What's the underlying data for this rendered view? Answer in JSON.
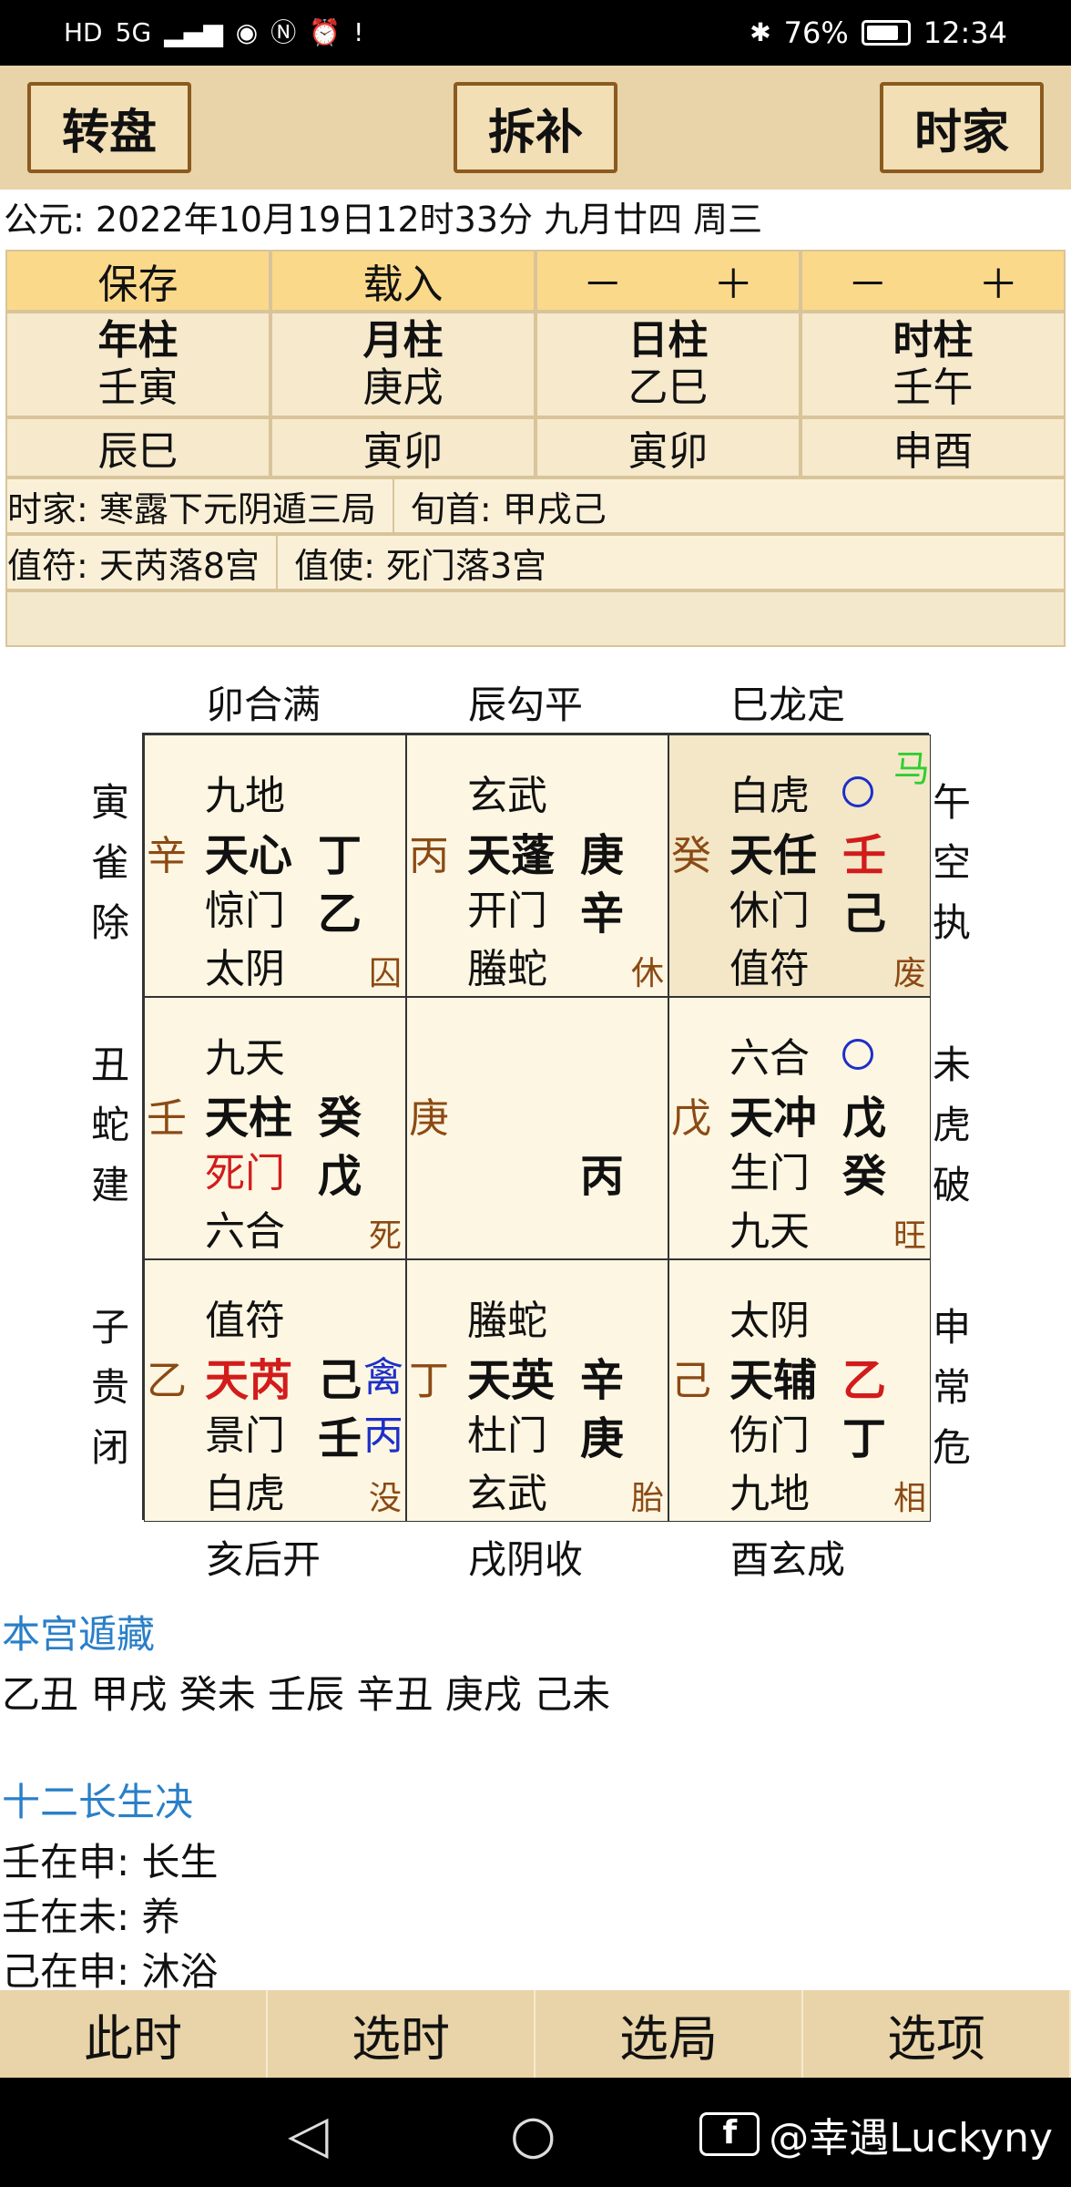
{
  "status_bar": {
    "left_icons": [
      "HD",
      "5G",
      "signal",
      "eye",
      "nfc",
      "alarm",
      "!"
    ],
    "battery": "76%",
    "time": "12:34"
  },
  "toolbar": {
    "rotate_label": "转盘",
    "split_label": "拆补",
    "shijia_label": "时家"
  },
  "date_line": "公元:  2022年10月19日12时33分 九月廿四 周三",
  "pillars": {
    "save_label": "保存",
    "load_label": "载入",
    "minus_label": "－",
    "plus_label": "＋",
    "headers": [
      "年柱",
      "月柱",
      "日柱",
      "时柱"
    ],
    "ganzhi": [
      "壬寅",
      "庚戌",
      "乙巳",
      "壬午"
    ],
    "kongwang": [
      "辰巳",
      "寅卯",
      "寅卯",
      "申酉"
    ],
    "ju": "时家: 寒露下元阴遁三局",
    "xunshou": "旬首: 甲戌己",
    "zhifu": "值符: 天芮落8宫",
    "zhishi": "值使: 死门落3宫"
  },
  "board": {
    "top_labels": [
      "卯合满",
      "辰勾平",
      "巳龙定"
    ],
    "bottom_labels": [
      "亥后开",
      "戌阴收",
      "酉玄成"
    ],
    "left_labels": [
      [
        "寅",
        "雀",
        "除"
      ],
      [
        "丑",
        "蛇",
        "建"
      ],
      [
        "子",
        "贵",
        "闭"
      ]
    ],
    "right_labels": [
      [
        "午",
        "空",
        "执"
      ],
      [
        "未",
        "虎",
        "破"
      ],
      [
        "申",
        "常",
        "危"
      ]
    ],
    "palaces": {
      "p4": {
        "stem": "辛",
        "god": "九地",
        "star": "天心",
        "sky": "丁",
        "door": "惊门",
        "earth": "乙",
        "deity": "太阴",
        "state": "囚"
      },
      "p9": {
        "stem": "丙",
        "god": "玄武",
        "star": "天蓬",
        "sky": "庚",
        "door": "开门",
        "earth": "辛",
        "deity": "螣蛇",
        "state": "休"
      },
      "p2": {
        "stem": "癸",
        "god": "白虎",
        "star": "天任",
        "sky": "壬",
        "door": "休门",
        "earth": "己",
        "deity": "值符",
        "state": "废",
        "horse": "马"
      },
      "p3": {
        "stem": "壬",
        "god": "九天",
        "star": "天柱",
        "sky": "癸",
        "door": "死门",
        "earth": "戊",
        "deity": "六合",
        "state": "死"
      },
      "p5": {
        "stem": "庚",
        "earth": "丙"
      },
      "p7": {
        "stem": "戊",
        "god": "六合",
        "star": "天冲",
        "sky": "戊",
        "door": "生门",
        "earth": "癸",
        "deity": "九天",
        "state": "旺"
      },
      "p8": {
        "stem": "乙",
        "god": "值符",
        "star": "天芮",
        "sky": "己",
        "door": "景门",
        "earth": "壬",
        "deity": "白虎",
        "state": "没",
        "qin": "禽",
        "qin_stem": "丙"
      },
      "p1": {
        "stem": "丁",
        "god": "螣蛇",
        "star": "天英",
        "sky": "辛",
        "door": "杜门",
        "earth": "庚",
        "deity": "玄武",
        "state": "胎"
      },
      "p6": {
        "stem": "己",
        "god": "太阴",
        "star": "天辅",
        "sky": "乙",
        "door": "伤门",
        "earth": "丁",
        "deity": "九地",
        "state": "相"
      }
    }
  },
  "hidden": {
    "title": "本宫遁藏",
    "text": "乙丑 甲戌 癸未 壬辰 辛丑 庚戌 己未"
  },
  "changsheng": {
    "title": "十二长生决",
    "lines": [
      "壬在申:  长生",
      "壬在未:  养",
      "己在申:  沐浴"
    ]
  },
  "bottom_tabs": [
    "此时",
    "选时",
    "选局",
    "选项"
  ],
  "watermark": "@幸遇Luckyny",
  "colors": {
    "accent": "#e8d4a8",
    "red": "#d21c1c",
    "blue": "#1d2fc9",
    "green": "#2fcf2f",
    "link": "#2a7fc8"
  }
}
